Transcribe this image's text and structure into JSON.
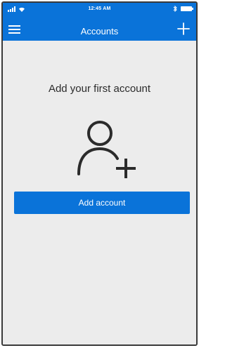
{
  "colors": {
    "accent": "#0a73d9",
    "background": "#ececec",
    "text": "#2b2b2b"
  },
  "status_bar": {
    "time": "12:45 AM"
  },
  "header": {
    "title": "Accounts",
    "menu_icon": "hamburger-menu-icon",
    "add_icon": "plus-icon"
  },
  "main": {
    "heading": "Add your first account",
    "illustration_icon": "add-person-icon",
    "primary_button_label": "Add account"
  }
}
